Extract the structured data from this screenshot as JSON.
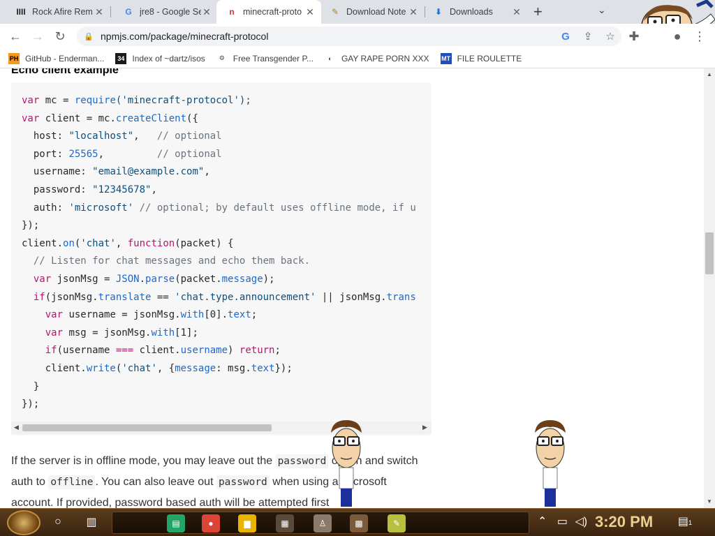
{
  "tabs": [
    {
      "title": "Rock Afire Rem",
      "favicon": "IIII",
      "favicon_color": "#222222",
      "active": false
    },
    {
      "title": "jre8 - Google Se",
      "favicon": "G",
      "favicon_color": "#4285f4",
      "active": false
    },
    {
      "title": "minecraft-proto",
      "favicon": "n",
      "favicon_color": "#cb3837",
      "active": true
    },
    {
      "title": "Download Note",
      "favicon": "✎",
      "favicon_color": "#a8891a",
      "active": false
    },
    {
      "title": "Downloads",
      "favicon": "⬇",
      "favicon_color": "#1a73e8",
      "active": false
    }
  ],
  "toolbar": {
    "url": "npmjs.com/package/minecraft-protocol"
  },
  "bookmarks": [
    {
      "label": "GitHub - Enderman...",
      "icon": "PH",
      "icon_bg": "#f7971e",
      "icon_fg": "#000000"
    },
    {
      "label": "Index of ~dartz/isos",
      "icon": "34",
      "icon_bg": "#1a1a1a",
      "icon_fg": "#ffffff"
    },
    {
      "label": "Free Transgender P...",
      "icon": "⚙",
      "icon_bg": "#ffffff",
      "icon_fg": "#444444"
    },
    {
      "label": "GAY RAPE PORN XXX",
      "icon": "◐",
      "icon_bg": "#ffffff",
      "icon_fg": "#444444"
    },
    {
      "label": "FILE ROULETTE",
      "icon": "MT",
      "icon_bg": "#1f4fbf",
      "icon_fg": "#ffffff"
    }
  ],
  "page": {
    "heading": "Echo client example",
    "code_lines": [
      [
        [
          "var",
          "kw"
        ],
        [
          " mc = ",
          ""
        ],
        [
          "require",
          "fn"
        ],
        [
          "('minecraft-protocol');",
          "str"
        ]
      ],
      [
        [
          "var",
          "kw"
        ],
        [
          " client = mc.",
          ""
        ],
        [
          "createClient",
          "fn"
        ],
        [
          "({",
          ""
        ]
      ],
      [
        [
          "  host: ",
          ""
        ],
        [
          "\"localhost\"",
          "str"
        ],
        [
          ",   ",
          ""
        ],
        [
          "// optional",
          "cm"
        ]
      ],
      [
        [
          "  port: ",
          ""
        ],
        [
          "25565",
          "num"
        ],
        [
          ",         ",
          ""
        ],
        [
          "// optional",
          "cm"
        ]
      ],
      [
        [
          "  username: ",
          ""
        ],
        [
          "\"email@example.com\"",
          "str"
        ],
        [
          ",",
          ""
        ]
      ],
      [
        [
          "  password: ",
          ""
        ],
        [
          "\"12345678\"",
          "str"
        ],
        [
          ",",
          ""
        ]
      ],
      [
        [
          "  auth: ",
          ""
        ],
        [
          "'microsoft'",
          "str"
        ],
        [
          " ",
          ""
        ],
        [
          "// optional; by default uses offline mode, if u",
          "cm"
        ]
      ],
      [
        [
          "});",
          ""
        ]
      ],
      [
        [
          "client.",
          ""
        ],
        [
          "on",
          "fn"
        ],
        [
          "(",
          ""
        ],
        [
          "'chat'",
          "str"
        ],
        [
          ", ",
          ""
        ],
        [
          "function",
          "kw"
        ],
        [
          "(packet) {",
          ""
        ]
      ],
      [
        [
          "  ",
          ""
        ],
        [
          "// Listen for chat messages and echo them back.",
          "cm"
        ]
      ],
      [
        [
          "  ",
          ""
        ],
        [
          "var",
          "kw"
        ],
        [
          " jsonMsg = ",
          ""
        ],
        [
          "JSON",
          "fn"
        ],
        [
          ".",
          ""
        ],
        [
          "parse",
          "fn"
        ],
        [
          "(packet.",
          ""
        ],
        [
          "message",
          "fn"
        ],
        [
          ");",
          ""
        ]
      ],
      [
        [
          "  ",
          ""
        ],
        [
          "if",
          "kw"
        ],
        [
          "(jsonMsg.",
          ""
        ],
        [
          "translate",
          "fn"
        ],
        [
          " == ",
          ""
        ],
        [
          "'chat.type.announcement'",
          "str"
        ],
        [
          " || jsonMsg.",
          ""
        ],
        [
          "trans",
          "fn"
        ]
      ],
      [
        [
          "    ",
          ""
        ],
        [
          "var",
          "kw"
        ],
        [
          " username = jsonMsg.",
          ""
        ],
        [
          "with",
          "fn"
        ],
        [
          "[0].",
          ""
        ],
        [
          "text",
          "fn"
        ],
        [
          ";",
          ""
        ]
      ],
      [
        [
          "    ",
          ""
        ],
        [
          "var",
          "kw"
        ],
        [
          " msg = jsonMsg.",
          ""
        ],
        [
          "with",
          "fn"
        ],
        [
          "[1];",
          ""
        ]
      ],
      [
        [
          "    ",
          ""
        ],
        [
          "if",
          "kw"
        ],
        [
          "(username ",
          ""
        ],
        [
          "===",
          "kw"
        ],
        [
          " client.",
          ""
        ],
        [
          "username",
          "fn"
        ],
        [
          ") ",
          ""
        ],
        [
          "return",
          "kw"
        ],
        [
          ";",
          ""
        ]
      ],
      [
        [
          "    client.",
          ""
        ],
        [
          "write",
          "fn"
        ],
        [
          "(",
          ""
        ],
        [
          "'chat'",
          "str"
        ],
        [
          ", {",
          ""
        ],
        [
          "message",
          "fn"
        ],
        [
          ": msg.",
          ""
        ],
        [
          "text",
          "fn"
        ],
        [
          "});",
          ""
        ]
      ],
      [
        [
          "  }",
          ""
        ]
      ],
      [
        [
          "});",
          ""
        ]
      ]
    ],
    "paragraph": [
      [
        "If the server is in offline mode, you may leave out the ",
        "text"
      ],
      [
        "password",
        "code"
      ],
      [
        " option and switch auth to ",
        "text"
      ],
      [
        "offline",
        "code"
      ],
      [
        ". You can also leave out ",
        "text"
      ],
      [
        "password",
        "code"
      ],
      [
        " when using a Microsoft account. If provided, password based auth will be attempted first",
        "text"
      ]
    ]
  },
  "taskbar": {
    "time": "3:20 PM",
    "notification_count": "1",
    "apps": [
      {
        "name": "sheets",
        "glyph": "▤",
        "bg": "#23a566"
      },
      {
        "name": "chrome",
        "glyph": "●",
        "bg": "#db4437"
      },
      {
        "name": "file-explorer",
        "glyph": "▆",
        "bg": "#e8b400"
      },
      {
        "name": "radio",
        "glyph": "▦",
        "bg": "#5a4a3a"
      },
      {
        "name": "app-figure",
        "glyph": "♙",
        "bg": "#8a7a6a"
      },
      {
        "name": "minecraft",
        "glyph": "▩",
        "bg": "#7a5a3a"
      },
      {
        "name": "notepad",
        "glyph": "✎",
        "bg": "#b8c040"
      }
    ]
  }
}
